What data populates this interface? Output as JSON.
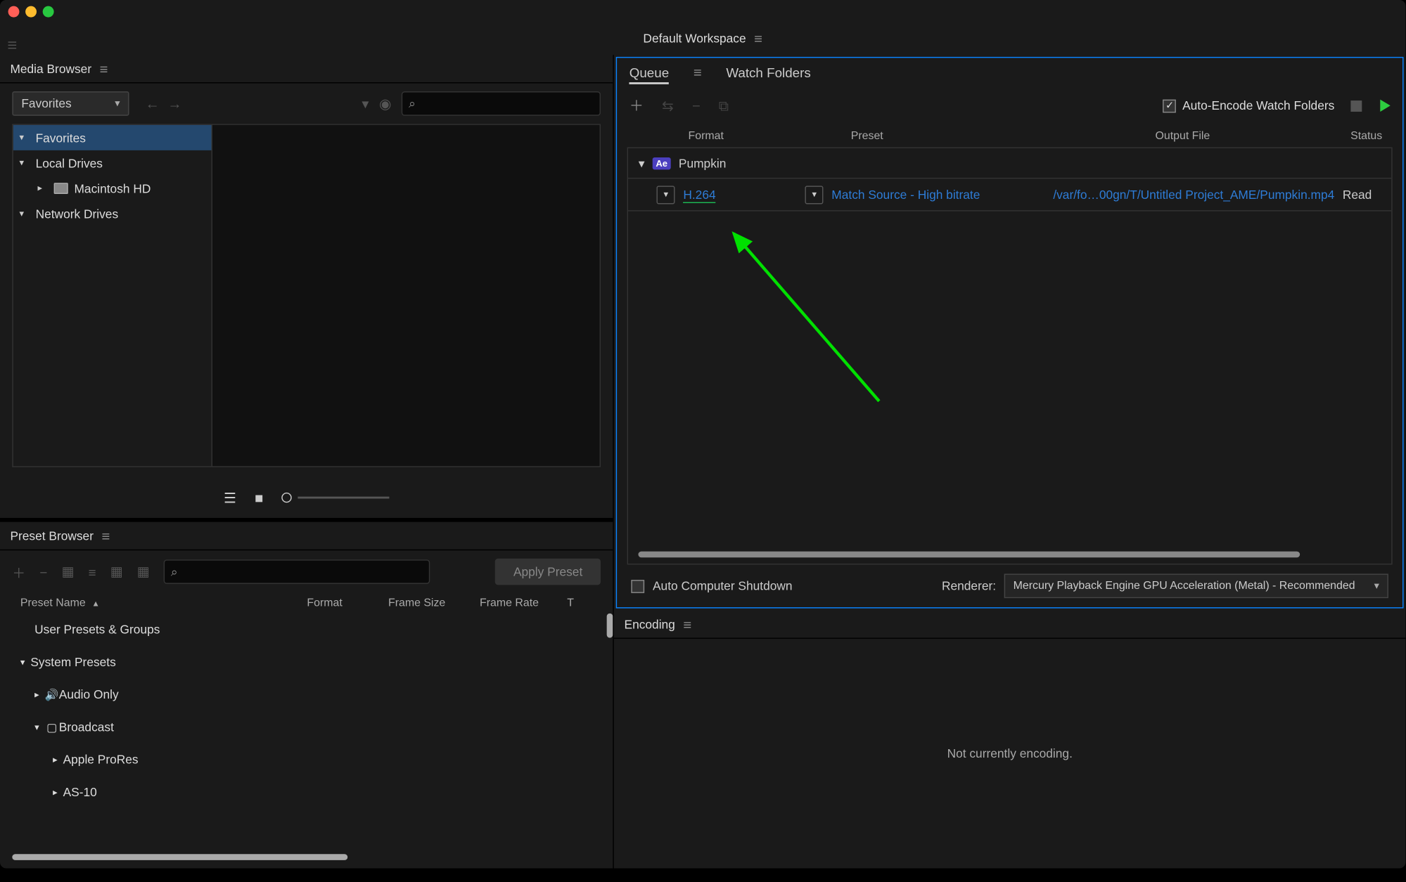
{
  "workspace": {
    "label": "Default Workspace"
  },
  "media_browser": {
    "title": "Media Browser",
    "dropdown": "Favorites",
    "search_placeholder": "",
    "tree": {
      "favorites": "Favorites",
      "local_drives": "Local Drives",
      "macintosh_hd": "Macintosh HD",
      "network_drives": "Network Drives"
    }
  },
  "preset_browser": {
    "title": "Preset Browser",
    "apply_label": "Apply Preset",
    "headers": {
      "name": "Preset Name",
      "format": "Format",
      "frame_size": "Frame Size",
      "frame_rate": "Frame Rate",
      "t": "T"
    },
    "rows": {
      "user_presets": "User Presets & Groups",
      "system_presets": "System Presets",
      "audio_only": "Audio Only",
      "broadcast": "Broadcast",
      "apple_prores": "Apple ProRes",
      "as10": "AS-10"
    }
  },
  "queue": {
    "tab_queue": "Queue",
    "tab_watch": "Watch Folders",
    "auto_encode": "Auto-Encode Watch Folders",
    "headers": {
      "format": "Format",
      "preset": "Preset",
      "output": "Output File",
      "status": "Status"
    },
    "source": {
      "name": "Pumpkin",
      "badge": "Ae"
    },
    "output": {
      "format": "H.264",
      "preset": "Match Source - High bitrate",
      "file": "/var/fo…00gn/T/Untitled Project_AME/Pumpkin.mp4",
      "status": "Read"
    },
    "auto_shutdown": "Auto Computer Shutdown",
    "renderer_label": "Renderer:",
    "renderer_value": "Mercury Playback Engine GPU Acceleration (Metal) - Recommended"
  },
  "encoding": {
    "title": "Encoding",
    "status": "Not currently encoding."
  }
}
